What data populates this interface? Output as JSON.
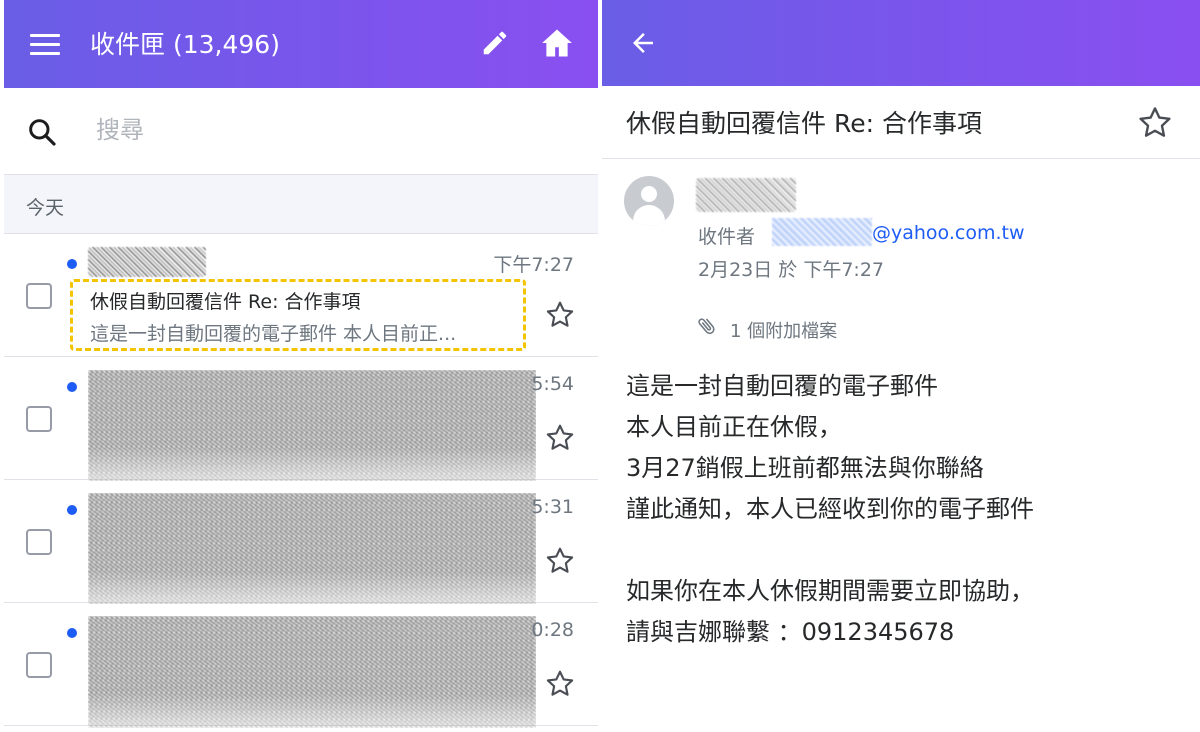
{
  "left_panel": {
    "header": {
      "title": "收件匣",
      "count": "(13,496)"
    },
    "search": {
      "placeholder": "搜尋"
    },
    "section": {
      "label": "今天"
    },
    "messages": [
      {
        "time": "下午7:27",
        "subject": "休假自動回覆信件 Re: 合作事項",
        "snippet": "這是一封自動回覆的電子郵件 本人目前正..."
      },
      {
        "time": "5:54"
      },
      {
        "time": "5:31"
      },
      {
        "time": "0:28"
      }
    ]
  },
  "right_panel": {
    "subject": "休假自動回覆信件 Re: 合作事項",
    "to_label": "收件者",
    "to_email": "@yahoo.com.tw",
    "date": "2月23日 於 下午7:27",
    "attachments": "1 個附加檔案",
    "body_lines": [
      "這是一封自動回覆的電子郵件",
      "本人目前正在休假，",
      "3月27銷假上班前都無法與你聯絡",
      "謹此通知，本人已經收到你的電子郵件",
      "",
      "如果你在本人休假期間需要立即協助，",
      "請與吉娜聯繫 ：0912345678"
    ]
  },
  "icons": {
    "menu": "hamburger-menu-icon",
    "compose": "pencil-icon",
    "home": "home-icon",
    "search": "search-icon",
    "star": "star-outline-icon",
    "back": "arrow-left-icon",
    "avatar": "person-icon",
    "attachment": "paperclip-icon"
  },
  "colors": {
    "header_gradient_start": "#6a5ee6",
    "header_gradient_end": "#8a4ff0",
    "unread_dot": "#1e5df5",
    "highlight_border": "#f2c500",
    "link": "#1e5df5"
  }
}
